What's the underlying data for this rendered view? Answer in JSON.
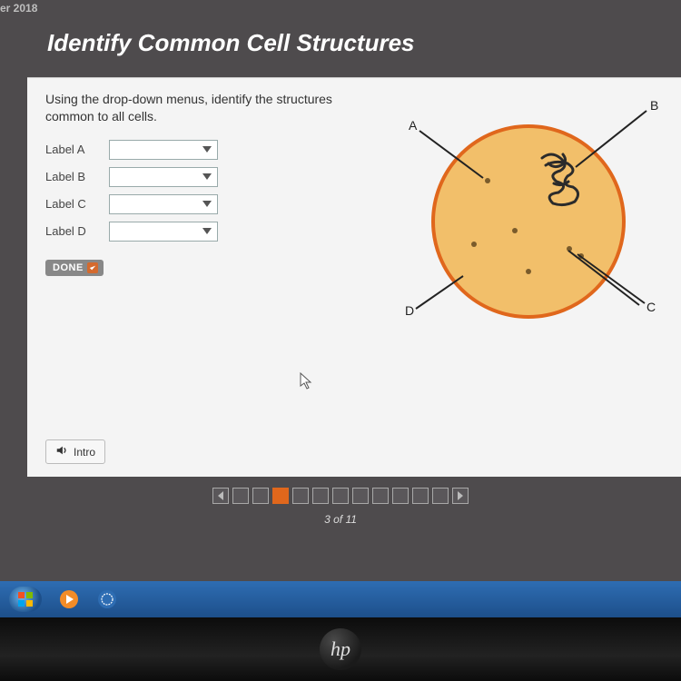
{
  "header": {
    "corner": "er 2018",
    "title": "Identify Common Cell Structures"
  },
  "instructions": "Using the drop-down menus, identify the structures common to all cells.",
  "labels": [
    {
      "text": "Label A",
      "value": ""
    },
    {
      "text": "Label B",
      "value": ""
    },
    {
      "text": "Label C",
      "value": ""
    },
    {
      "text": "Label D",
      "value": ""
    }
  ],
  "done_label": "DONE",
  "intro_label": "Intro",
  "diagram": {
    "markers": {
      "A": "A",
      "B": "B",
      "C": "C",
      "D": "D"
    }
  },
  "progress": {
    "total": 11,
    "current": 3,
    "text": "3 of 11"
  },
  "logo": "hp"
}
